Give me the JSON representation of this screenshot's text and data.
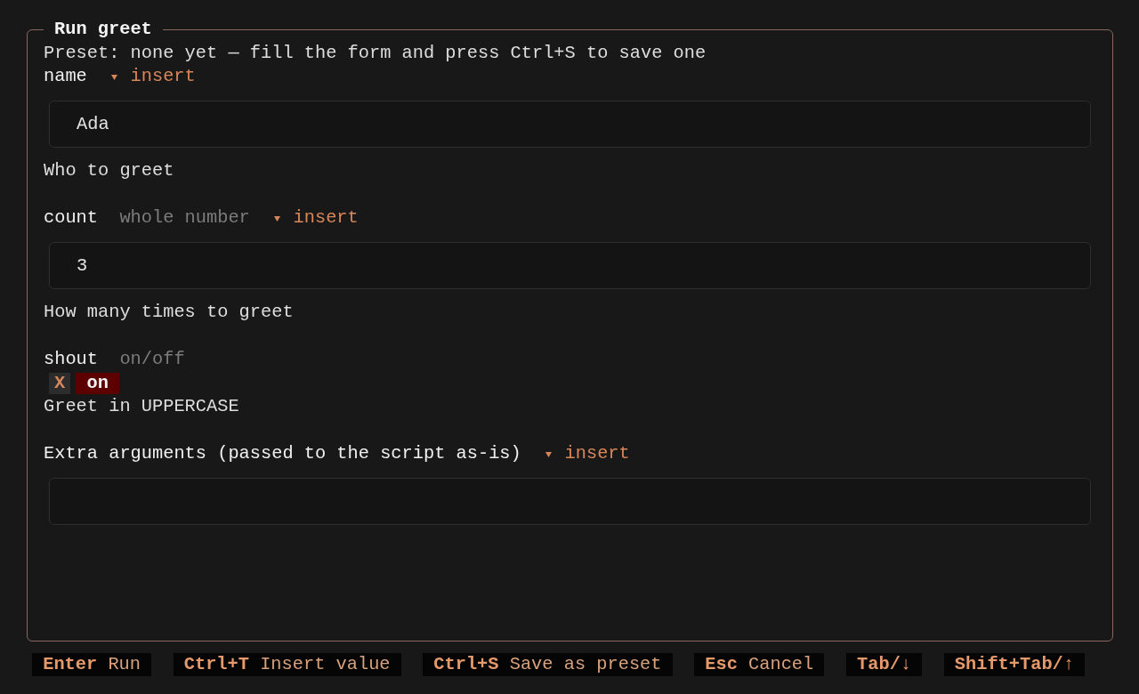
{
  "panel": {
    "title": "Run greet",
    "preset_status": "Preset: none yet — fill the form and press Ctrl+S to save one"
  },
  "fields": [
    {
      "kind": "text",
      "label": "name",
      "insert_button": "insert",
      "value": "Ada",
      "help": "Who to greet"
    },
    {
      "kind": "text",
      "label": "count",
      "hint": "whole number",
      "insert_button": "insert",
      "value": "3",
      "help": "How many times to greet"
    },
    {
      "kind": "checkbox",
      "label": "shout",
      "hint": "on/off",
      "checkbox": {
        "mark": "X",
        "label": "on",
        "checked": true,
        "focused": true
      },
      "help": "Greet in UPPERCASE"
    },
    {
      "kind": "text",
      "label": "Extra arguments (passed to the script as-is)",
      "insert_button": "insert"
    }
  ],
  "footer": {
    "bindings": [
      {
        "key": "Enter",
        "description": "Run"
      },
      {
        "key": "Ctrl+T",
        "description": "Insert value"
      },
      {
        "key": "Ctrl+S",
        "description": "Save as preset"
      },
      {
        "key": "Esc",
        "description": "Cancel"
      },
      {
        "key": "Tab/↓"
      },
      {
        "key": "Shift+Tab/↑"
      }
    ]
  }
}
